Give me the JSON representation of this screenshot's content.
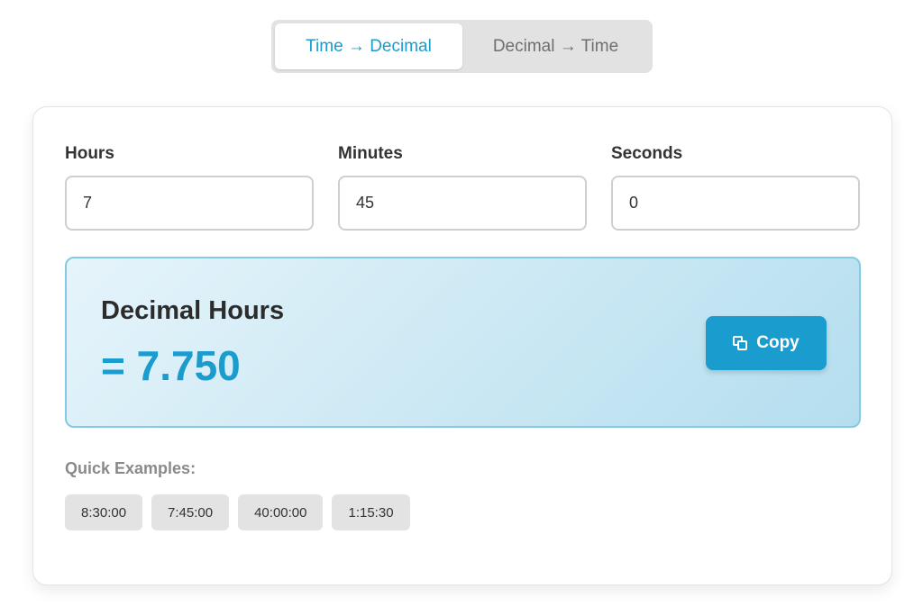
{
  "mode_tabs": [
    {
      "label": "Time → Decimal",
      "active": true
    },
    {
      "label": "Decimal → Time",
      "active": false
    }
  ],
  "inputs": {
    "hours": {
      "label": "Hours",
      "value": "7"
    },
    "minutes": {
      "label": "Minutes",
      "value": "45"
    },
    "seconds": {
      "label": "Seconds",
      "value": "0"
    }
  },
  "result": {
    "label": "Decimal Hours",
    "value": "= 7.750",
    "copy_label": "Copy",
    "copy_icon": "copy-icon"
  },
  "examples": {
    "label": "Quick Examples:",
    "items": [
      "8:30:00",
      "7:45:00",
      "40:00:00",
      "1:15:30"
    ]
  },
  "colors": {
    "accent": "#1a9ccf",
    "result_bg_start": "#e6f4fb",
    "result_bg_end": "#b4deef",
    "chip_bg": "#e3e3e3",
    "toggle_bg": "#e2e2e2"
  }
}
